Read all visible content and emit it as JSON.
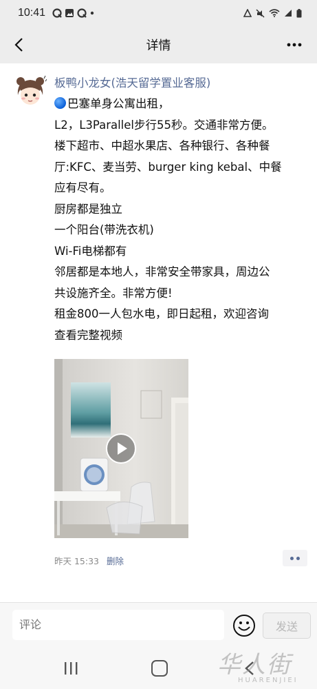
{
  "status_bar": {
    "time": "10:41",
    "notification_icons": [
      "q-app-icon",
      "image-icon",
      "q-app-icon",
      "more-dot-icon"
    ],
    "system_icons": [
      "data-saver-icon",
      "mute-icon",
      "wifi-icon",
      "signal-icon",
      "battery-icon"
    ]
  },
  "nav": {
    "title": "详情",
    "more_label": "•••"
  },
  "post": {
    "author": "板鸭小龙女(浩天留学置业客服)",
    "lines": [
      "巴塞单身公寓出租，",
      "L2，L3Parallel步行55秒。交通非常方便。",
      "楼下超市、中超水果店、各种银行、各种餐",
      "厅:KFC、麦当劳、burger king kebal、中餐",
      "应有尽有。",
      "厨房都是独立",
      "一个阳台(带洗衣机)",
      "Wi-Fi电梯都有",
      "邻居都是本地人，非常安全带家具，周边公",
      "共设施齐全。非常方便!",
      "租金800一人包水电，即日起租，欢迎咨询",
      "查看完整视频"
    ],
    "time": "昨天 15:33",
    "delete_label": "删除"
  },
  "comment": {
    "placeholder": "评论",
    "send_label": "发送"
  },
  "watermark": {
    "cn": "华人街",
    "en": "HUARENJIEI"
  },
  "colors": {
    "link": "#576b95",
    "background": "#ededed"
  }
}
